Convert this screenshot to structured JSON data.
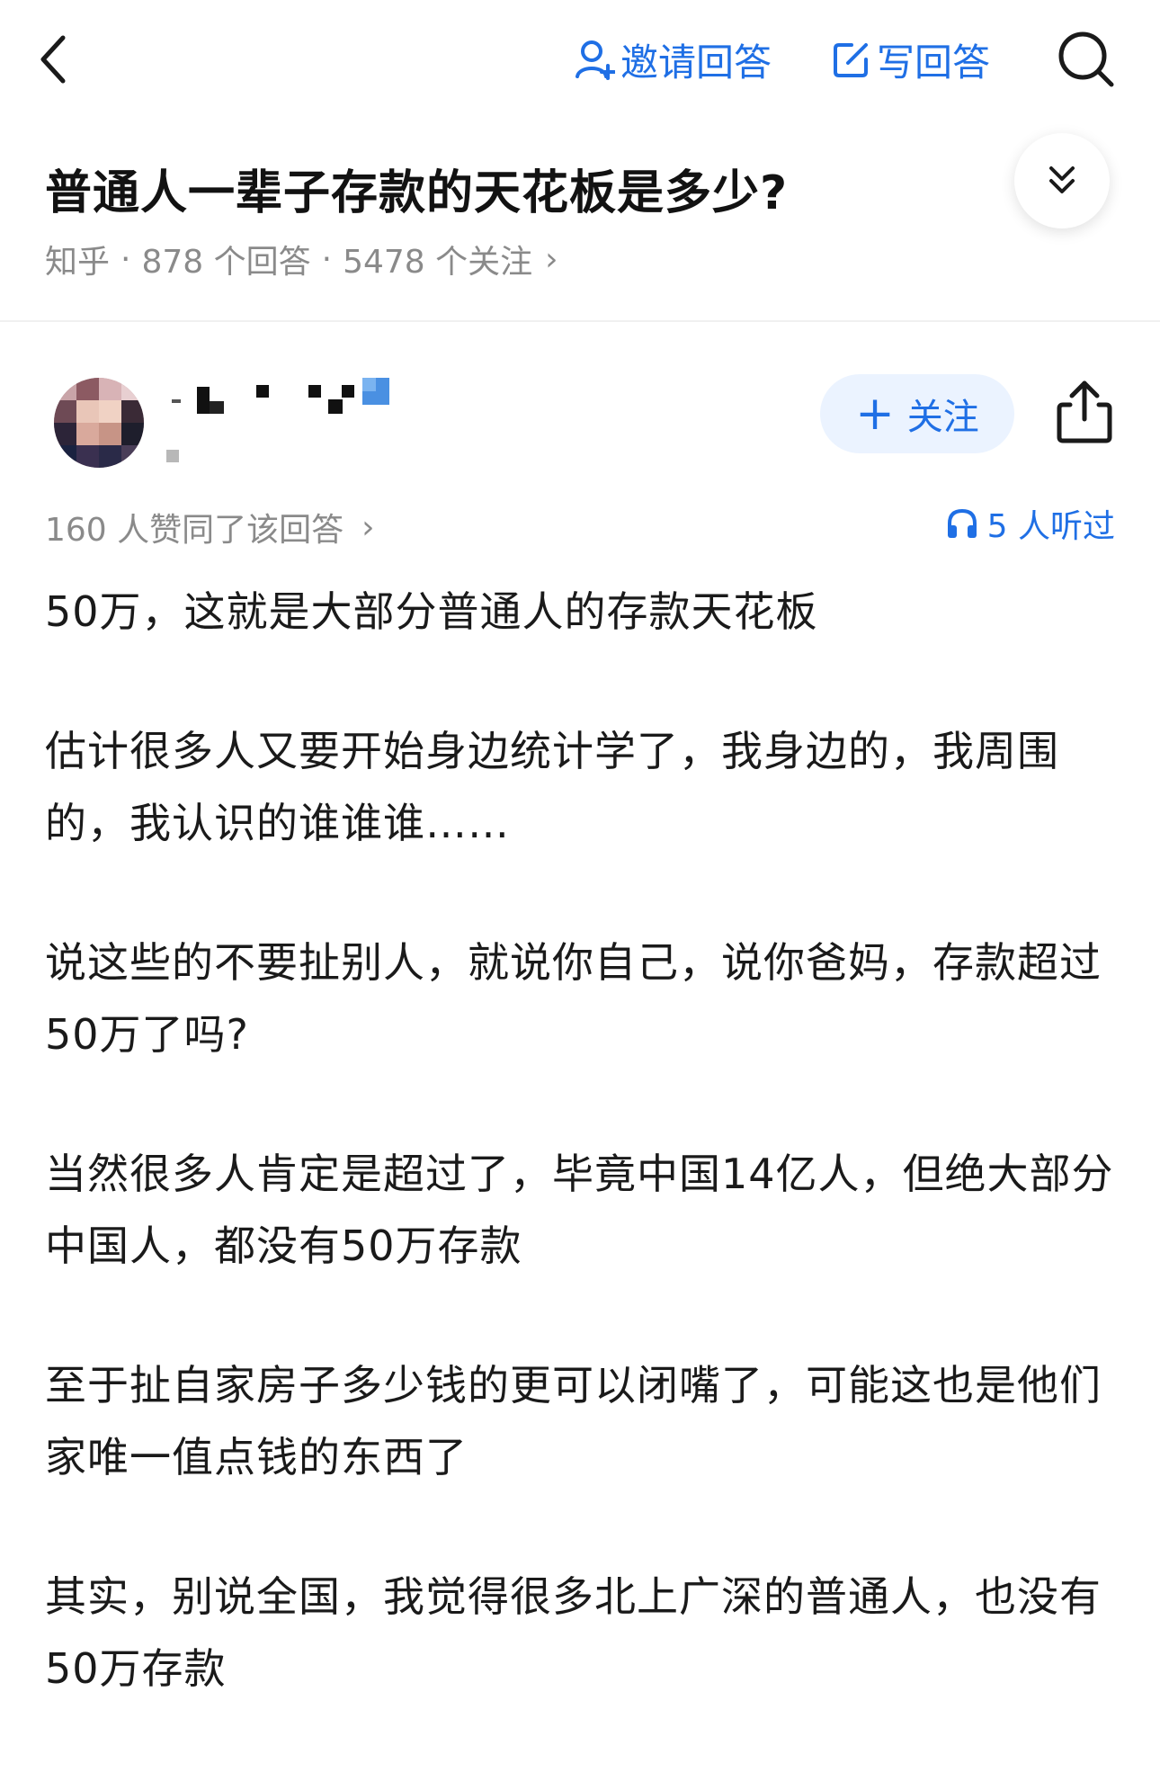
{
  "header": {
    "invite_label": "邀请回答",
    "write_label": "写回答"
  },
  "question": {
    "title": "普通人一辈子存款的天花板是多少?",
    "source": "知乎",
    "answers_count": "878 个回答",
    "followers_count": "5478 个关注",
    "chevron": "›"
  },
  "answer": {
    "follow_label": "关注",
    "follow_plus": "+",
    "upvotes_text": "160 人赞同了该回答",
    "upvotes_chevron": "›",
    "listen_text": "5 人听过",
    "paragraphs": [
      "50万，这就是大部分普通人的存款天花板",
      "估计很多人又要开始身边统计学了，我身边的，我周围的，我认识的谁谁谁……",
      "说这些的不要扯别人，就说你自己，说你爸妈，存款超过50万了吗?",
      "当然很多人肯定是超过了，毕竟中国14亿人，但绝大部分中国人，都没有50万存款",
      "至于扯自家房子多少钱的更可以闭嘴了，可能这也是他们家唯一值点钱的东西了",
      "其实，别说全国，我觉得很多北上广深的普通人，也没有50万存款"
    ]
  },
  "colors": {
    "accent": "#1f6fe5",
    "muted": "#8a8a8a",
    "follow_bg": "#ebf3ff"
  },
  "icons": [
    "back-arrow-icon",
    "invite-user-icon",
    "edit-icon",
    "search-icon",
    "collapse-chevrons-icon",
    "share-icon",
    "headphones-icon"
  ]
}
